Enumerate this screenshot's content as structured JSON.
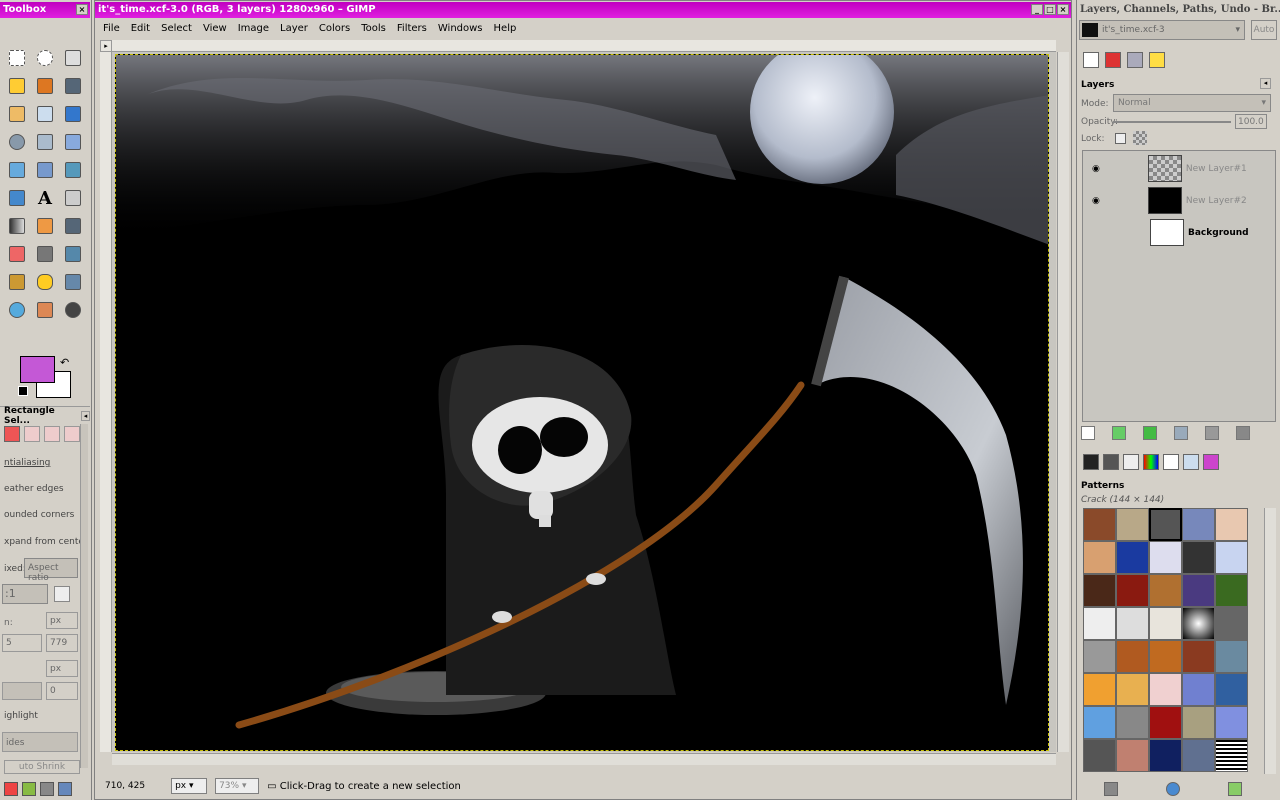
{
  "toolbox": {
    "title": "Toolbox",
    "tool_options_title": "Rectangle Sel...",
    "options": [
      "ntialiasing",
      "eather edges",
      "ounded corners",
      "xpand from center",
      "ixed:",
      "Aspect ratio",
      ":1",
      "n:",
      "px",
      "5",
      "779",
      "px",
      "0",
      "ighlight",
      "ides",
      "uto Shrink"
    ]
  },
  "main": {
    "title": "it's_time.xcf-3.0 (RGB, 3 layers) 1280x960 – GIMP",
    "menus": [
      "File",
      "Edit",
      "Select",
      "View",
      "Image",
      "Layer",
      "Colors",
      "Tools",
      "Filters",
      "Windows",
      "Help"
    ],
    "status": {
      "coords": "710, 425",
      "unit": "px",
      "zoom": "73%",
      "message": "Click-Drag to create a new selection"
    }
  },
  "dock": {
    "title": "Layers, Channels, Paths, Undo - Br...",
    "image_select": "it's_time.xcf-3",
    "auto_label": "Auto",
    "layers_label": "Layers",
    "mode_label": "Mode:",
    "mode_value": "Normal",
    "opacity_label": "Opacity:",
    "opacity_value": "100.0",
    "lock_label": "Lock:",
    "layers": [
      {
        "name": "New Layer#1",
        "visible": true
      },
      {
        "name": "New Layer#2",
        "visible": true
      },
      {
        "name": "Background",
        "visible": false
      }
    ],
    "patterns_label": "Patterns",
    "pattern_name": "Crack (144 × 144)"
  },
  "colors": {
    "foreground": "#c458d6",
    "background": "#ffffff",
    "title_bar": "#d010d0"
  }
}
